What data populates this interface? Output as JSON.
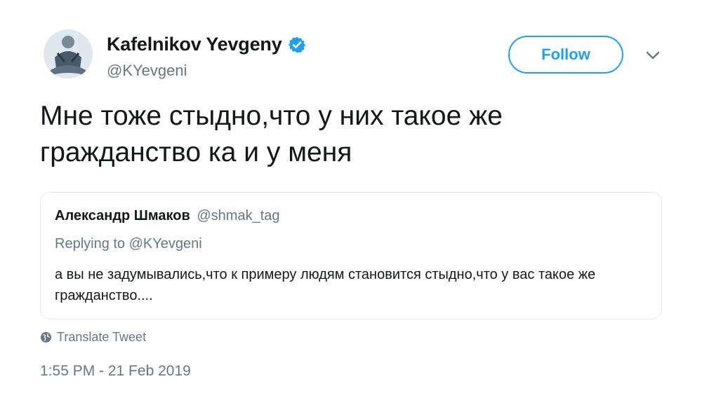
{
  "author": {
    "display_name": "Kafelnikov Yevgeny",
    "handle": "@KYevgeni",
    "verified": true
  },
  "actions": {
    "follow_label": "Follow"
  },
  "tweet": {
    "text": "Мне тоже стыдно,что у них такое же гражданство ка и у меня"
  },
  "quoted_tweet": {
    "author_name": "Александр Шмаков",
    "author_handle": "@shmak_tag",
    "replying_to": "Replying to @KYevgeni",
    "text": "а вы не задумывались,что к примеру людям становится стыдно,что у вас такое же гражданство...."
  },
  "translate_label": "Translate Tweet",
  "timestamp": "1:55 PM - 21 Feb 2019",
  "colors": {
    "accent": "#1da1f2",
    "text_primary": "#14171a",
    "text_secondary": "#657786",
    "border": "#e1e8ed"
  },
  "icons": {
    "verified": "verified-badge-icon",
    "caret": "chevron-down-icon",
    "translate": "globe-icon"
  }
}
